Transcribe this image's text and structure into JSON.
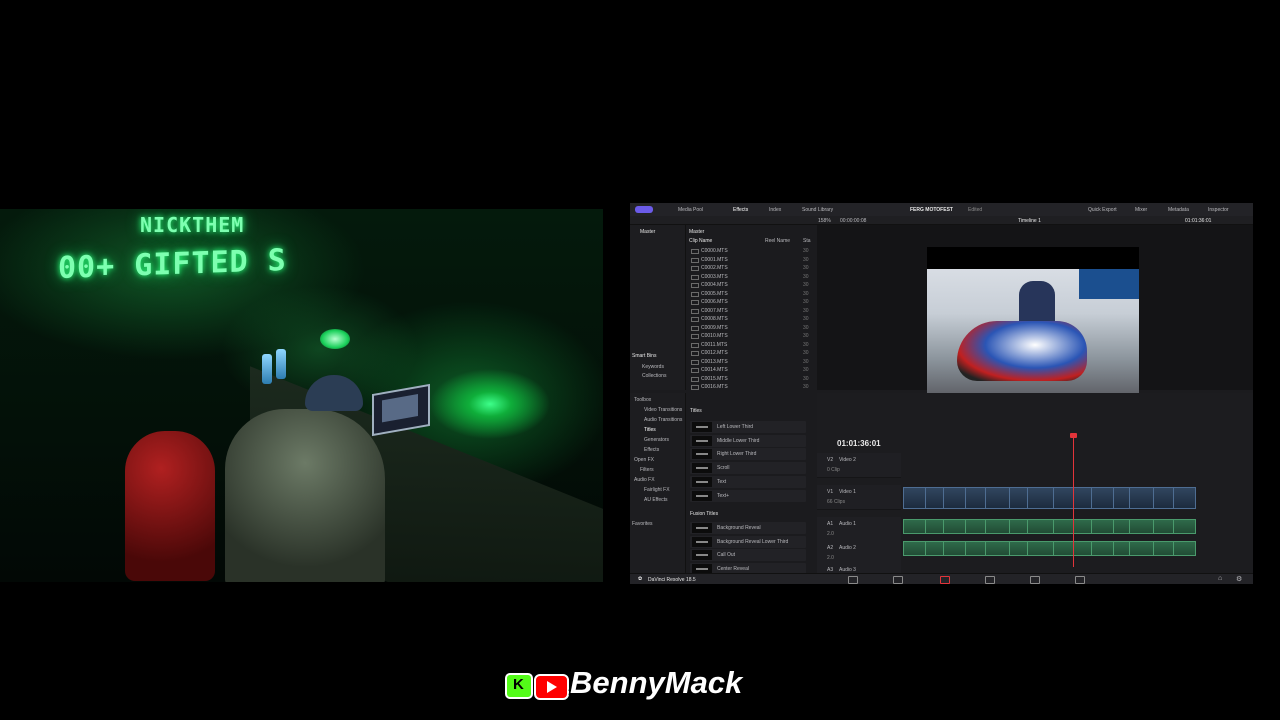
{
  "webcam": {
    "sign_line_1": "NICKTHEM",
    "sign_line_2": "00+ GIFTED S"
  },
  "resolve": {
    "top_tabs": [
      "Media Pool",
      "Effects",
      "Index",
      "Sound Library"
    ],
    "project_title": "FERG MOTOFEST",
    "project_state": "Edited",
    "right_tabs": [
      "Quick Export",
      "Mixer",
      "Metadata",
      "Inspector"
    ],
    "zoom": "158%",
    "viewer_timecode": "00:00:00:08",
    "timeline_name": "Timeline 1",
    "timeline_timecode_top": "01:01:36:01",
    "bins": {
      "master": "Master",
      "smart_bins": "Smart Bins",
      "keywords": "Keywords",
      "collections": "Collections"
    },
    "clip_list": {
      "header": "Master",
      "col_clip_name": "Clip Name",
      "col_reel_name": "Reel Name",
      "col_short": "Sta",
      "clips": [
        "C0000.MTS",
        "C0001.MTS",
        "C0002.MTS",
        "C0003.MTS",
        "C0004.MTS",
        "C0005.MTS",
        "C0006.MTS",
        "C0007.MTS",
        "C0008.MTS",
        "C0009.MTS",
        "C0010.MTS",
        "C0011.MTS",
        "C0012.MTS",
        "C0013.MTS",
        "C0014.MTS",
        "C0015.MTS",
        "C0016.MTS"
      ],
      "short_value": "30"
    },
    "fx_tree": [
      "Toolbox",
      "Video Transitions",
      "Audio Transitions",
      "Titles",
      "Generators",
      "Effects",
      "Open FX",
      "Filters",
      "Audio FX",
      "Fairlight FX",
      "AU Effects",
      "Favorites"
    ],
    "titles_header": "Titles",
    "titles": [
      "Left Lower Third",
      "Middle Lower Third",
      "Right Lower Third",
      "Scroll",
      "Text",
      "Text+"
    ],
    "fusion_header": "Fusion Titles",
    "fusion_titles": [
      "Background Reveal",
      "Background Reveal Lower Third",
      "Call Out",
      "Center Reveal"
    ],
    "timeline": {
      "timecode": "01:01:36:01",
      "tracks": [
        {
          "id": "V2",
          "name": "Video 2",
          "sub": "0 Clip"
        },
        {
          "id": "V1",
          "name": "Video 1",
          "sub": "66 Clips"
        },
        {
          "id": "A1",
          "name": "Audio 1",
          "sub": "2.0"
        },
        {
          "id": "A2",
          "name": "Audio 2",
          "sub": "2.0"
        },
        {
          "id": "A3",
          "name": "Audio 3",
          "sub": ""
        }
      ]
    },
    "app_name": "DaVinci Resolve 18.5"
  },
  "brand": {
    "kick_letter": "K",
    "name": "BennyMack"
  },
  "colors": {
    "accent": "#e2343a",
    "brand_purple": "#6b5be8",
    "neon_green": "#29ff7a",
    "kick_green": "#53fc18",
    "youtube_red": "#ff0000"
  }
}
